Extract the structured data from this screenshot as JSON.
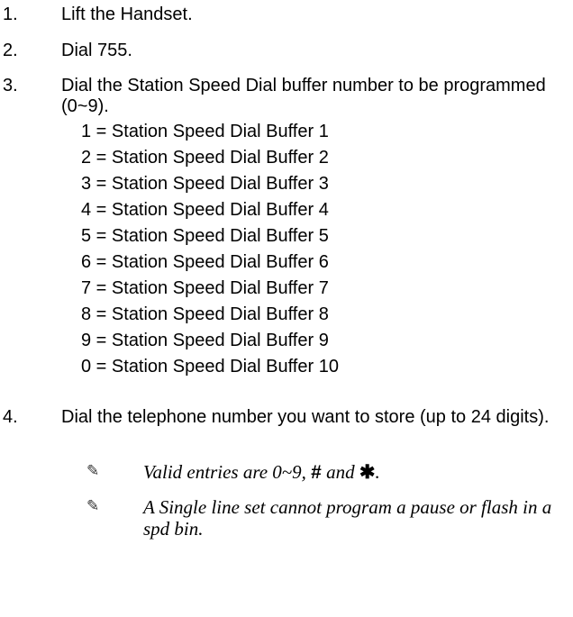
{
  "steps": [
    {
      "num": "1.",
      "text": "Lift the Handset."
    },
    {
      "num": "2.",
      "text": "Dial 755."
    },
    {
      "num": "3.",
      "text": "Dial the Station Speed Dial buffer number to be programmed (0~9)."
    },
    {
      "num": "4.",
      "text": "Dial the telephone number you want to store (up to 24 digits)."
    }
  ],
  "buffers": [
    "1 = Station Speed Dial Buffer 1",
    "2 = Station Speed Dial Buffer 2",
    "3 = Station Speed Dial Buffer 3",
    "4 = Station Speed Dial Buffer 4",
    "5 = Station Speed Dial Buffer 5",
    "6 = Station Speed Dial Buffer 6",
    "7 = Station Speed Dial Buffer 7",
    "8 = Station Speed Dial Buffer 8",
    "9 = Station Speed Dial Buffer 9",
    "0 = Station Speed Dial Buffer 10"
  ],
  "notes": {
    "icon": "pencil-note-icon",
    "note1": {
      "prefix": "Valid entries are 0~9, ",
      "hash": "#",
      "middle": " and ",
      "star": "✱",
      "suffix": "."
    },
    "note2": "A Single line set cannot program a pause or flash in a spd bin."
  }
}
